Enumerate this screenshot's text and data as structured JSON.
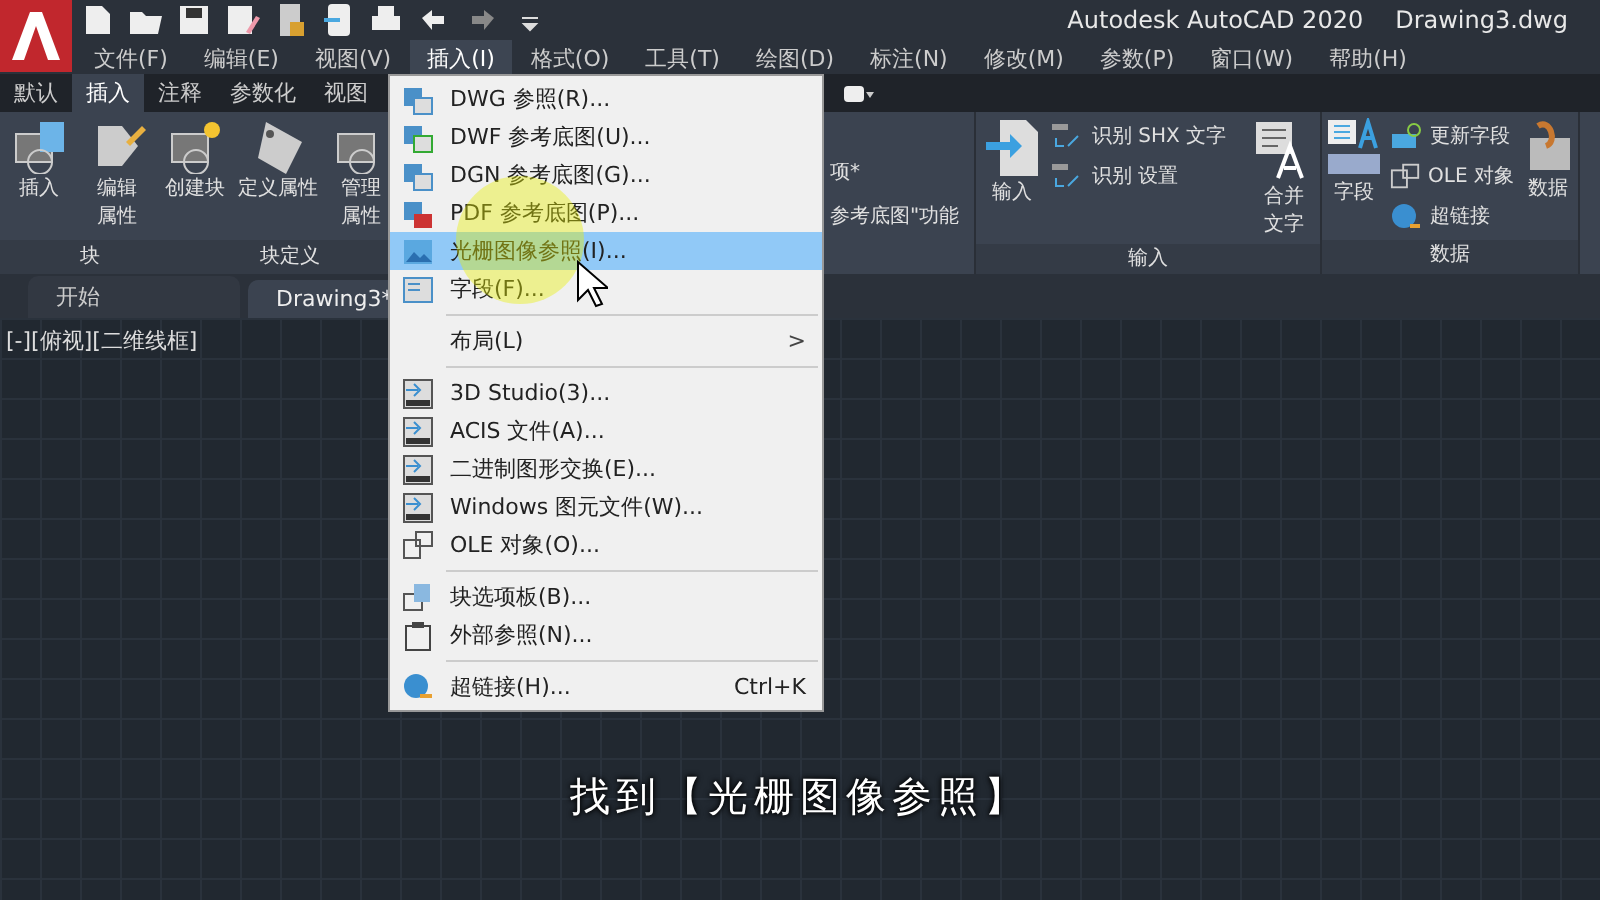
{
  "title_bar": {
    "app": "Autodesk AutoCAD 2020",
    "file": "Drawing3.dwg"
  },
  "menu_bar": [
    {
      "label": "文件(F)",
      "selected": false
    },
    {
      "label": "编辑(E)",
      "selected": false
    },
    {
      "label": "视图(V)",
      "selected": false
    },
    {
      "label": "插入(I)",
      "selected": true
    },
    {
      "label": "格式(O)",
      "selected": false
    },
    {
      "label": "工具(T)",
      "selected": false
    },
    {
      "label": "绘图(D)",
      "selected": false
    },
    {
      "label": "标注(N)",
      "selected": false
    },
    {
      "label": "修改(M)",
      "selected": false
    },
    {
      "label": "参数(P)",
      "selected": false
    },
    {
      "label": "窗口(W)",
      "selected": false
    },
    {
      "label": "帮助(H)",
      "selected": false
    }
  ],
  "ribbon_tabs": [
    {
      "label": "默认",
      "selected": false
    },
    {
      "label": "插入",
      "selected": true
    },
    {
      "label": "注释",
      "selected": false
    },
    {
      "label": "参数化",
      "selected": false
    },
    {
      "label": "视图",
      "selected": false
    }
  ],
  "ribbon_left": {
    "tools": [
      [
        "插入"
      ],
      [
        "编辑",
        "属性"
      ],
      [
        "创建块"
      ],
      [
        "定义属性"
      ],
      [
        "管理",
        "属性"
      ]
    ],
    "groups": [
      "块",
      "块定义"
    ]
  },
  "ribbon_middle": {
    "texts": [
      "项*",
      "参考底图\"功能"
    ]
  },
  "ribbon_import": {
    "large": "输入",
    "small": [
      "识别 SHX 文字",
      "识别 设置"
    ],
    "merge": [
      "合并",
      "文字"
    ],
    "group": "输入"
  },
  "ribbon_data": {
    "large": "字段",
    "small": [
      "更新字段",
      "OLE 对象",
      "超链接"
    ],
    "cut": "数据",
    "group": "数据"
  },
  "doc_tabs": [
    {
      "label": "开始",
      "selected": false
    },
    {
      "label": "Drawing3*",
      "selected": true
    }
  ],
  "viewport_label": "[-][俯视][二维线框]",
  "insert_menu": [
    {
      "kind": "item",
      "label": "DWG 参照(R)...",
      "selected": false
    },
    {
      "kind": "item",
      "label": "DWF 参考底图(U)...",
      "selected": false
    },
    {
      "kind": "item",
      "label": "DGN 参考底图(G)...",
      "selected": false
    },
    {
      "kind": "item",
      "label": "PDF 参考底图(P)...",
      "selected": false
    },
    {
      "kind": "item",
      "label": "光栅图像参照(I)...",
      "selected": true
    },
    {
      "kind": "item",
      "label": "字段(F)...",
      "selected": false
    },
    {
      "kind": "separator"
    },
    {
      "kind": "submenu",
      "label": "布局(L)",
      "arrow": ">",
      "selected": false
    },
    {
      "kind": "separator"
    },
    {
      "kind": "item",
      "label": "3D Studio(3)...",
      "selected": false
    },
    {
      "kind": "item",
      "label": "ACIS 文件(A)...",
      "selected": false
    },
    {
      "kind": "item",
      "label": "二进制图形交换(E)...",
      "selected": false
    },
    {
      "kind": "item",
      "label": "Windows 图元文件(W)...",
      "selected": false
    },
    {
      "kind": "item",
      "label": "OLE 对象(O)...",
      "selected": false
    },
    {
      "kind": "separator"
    },
    {
      "kind": "item",
      "label": "块选项板(B)...",
      "selected": false
    },
    {
      "kind": "item",
      "label": "外部参照(N)...",
      "selected": false
    },
    {
      "kind": "separator"
    },
    {
      "kind": "item",
      "label": "超链接(H)...",
      "shortcut": "Ctrl+K",
      "selected": false
    }
  ],
  "caption": "找到【光栅图像参照】"
}
